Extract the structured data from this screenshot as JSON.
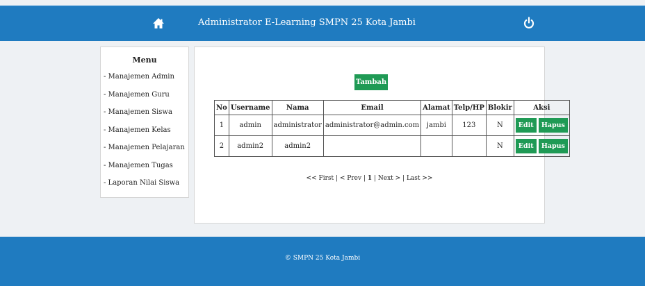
{
  "header": {
    "title": "Administrator E-Learning SMPN 25 Kota Jambi",
    "home_icon": "home-icon",
    "power_icon": "power-icon"
  },
  "sidebar": {
    "title": "Menu",
    "items": [
      "- Manajemen Admin",
      "- Manajemen Guru",
      "- Manajemen Siswa",
      "- Manajemen Kelas",
      "- Manajemen Pelajaran",
      "- Manajemen Tugas",
      "- Laporan Nilai Siswa"
    ]
  },
  "main": {
    "add_label": "Tambah",
    "table": {
      "headers": [
        "No",
        "Username",
        "Nama",
        "Email",
        "Alamat",
        "Telp/HP",
        "Blokir",
        "Aksi"
      ],
      "rows": [
        [
          "1",
          "admin",
          "administrator",
          "administrator@admin.com",
          "jambi",
          "123",
          "N"
        ],
        [
          "2",
          "admin2",
          "admin2",
          "",
          "",
          "",
          "N"
        ]
      ],
      "edit_label": "Edit",
      "delete_label": "Hapus"
    },
    "pager": {
      "first": "<< First",
      "prev": "< Prev",
      "current": "1",
      "next": "Next >",
      "last": "Last >>",
      "separator": " | "
    }
  },
  "footer": {
    "text": "© SMPN 25 Kota Jambi"
  },
  "colors": {
    "header_bg": "#1f7bc0",
    "button_green": "#1f9a55",
    "page_bg": "#eef1f4"
  }
}
